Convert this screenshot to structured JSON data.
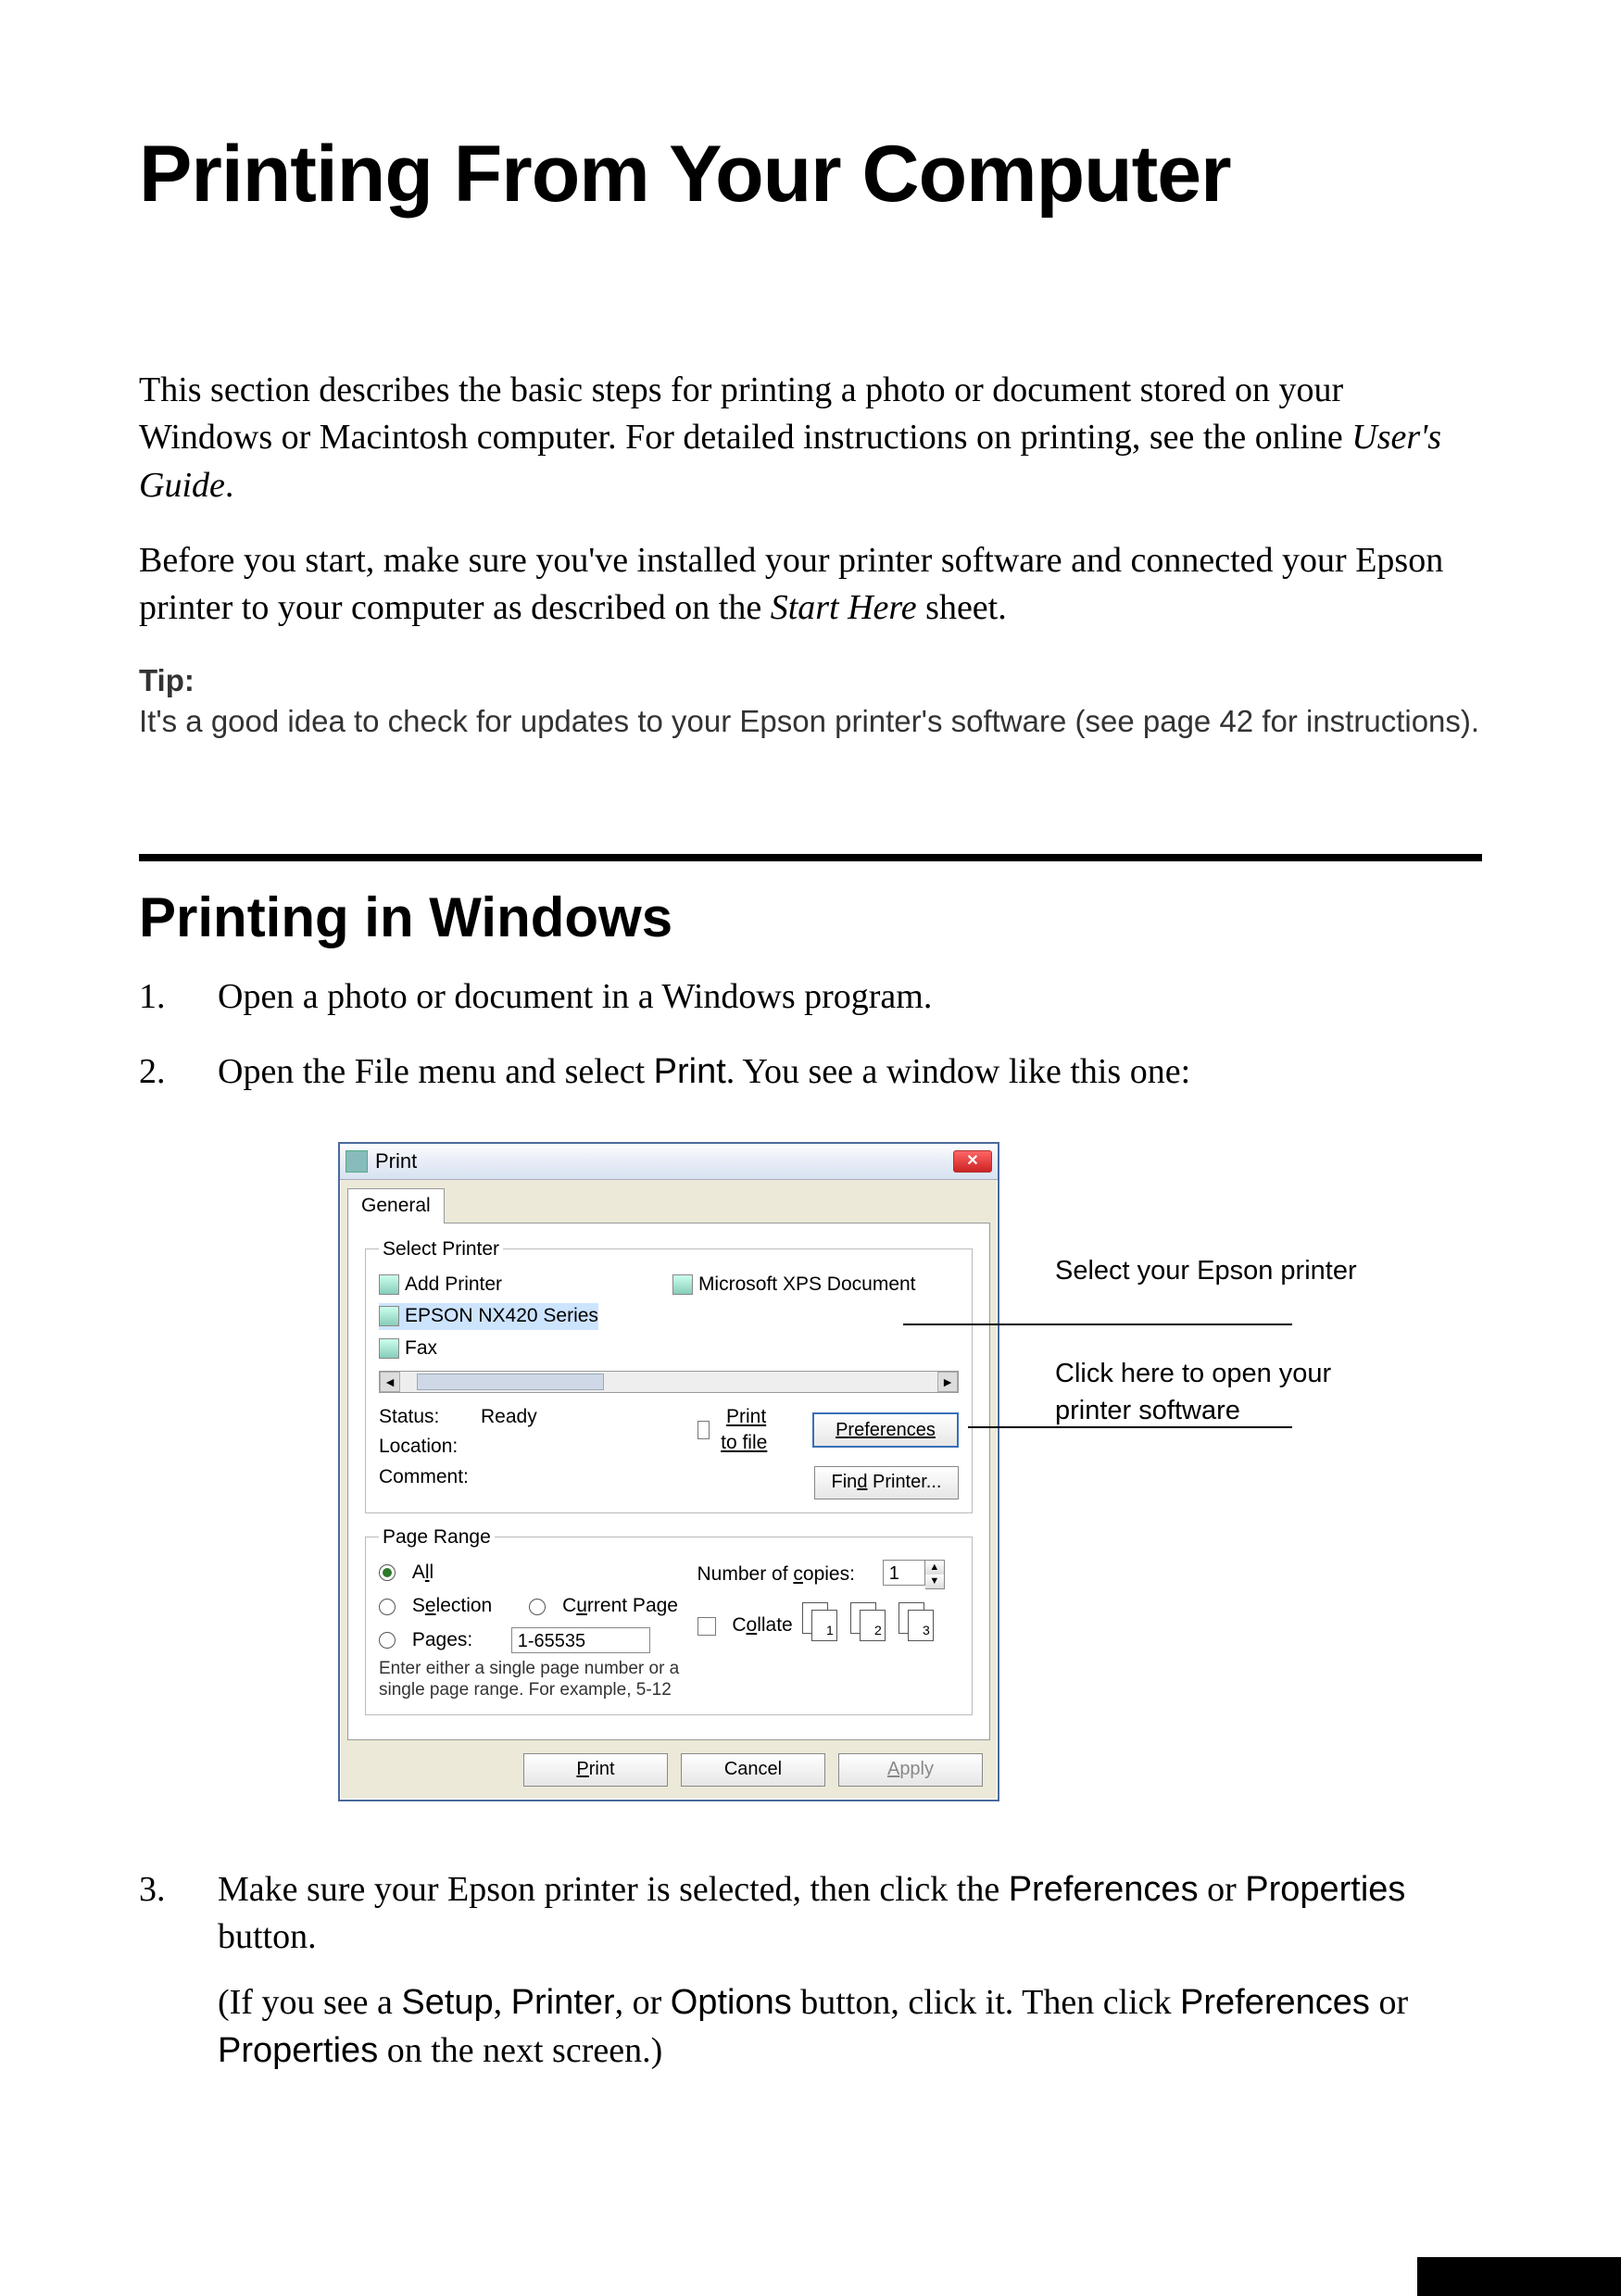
{
  "title": "Printing From Your Computer",
  "intro1_a": "This section describes the basic steps for printing a photo or document stored on your Windows or Macintosh computer. For detailed instructions on printing, see the online ",
  "intro1_em": "User's Guide",
  "intro1_b": ".",
  "intro2_a": "Before you start, make sure you've installed your printer software and connected your Epson printer to your computer as described on the ",
  "intro2_em": "Start Here",
  "intro2_b": " sheet.",
  "tip_label": "Tip:",
  "tip_body": "It's a good idea to check for updates to your Epson printer's software (see page 42 for instructions).",
  "section": "Printing in Windows",
  "steps": {
    "s1": "Open a photo or document in a Windows program.",
    "s2_a": "Open the File menu and select ",
    "s2_b": "Print",
    "s2_c": ". You see a window like this one:",
    "s3_a": "Make sure your Epson printer is selected, then click the ",
    "s3_b": "Preferences",
    "s3_c": " or ",
    "s3_d": "Properties",
    "s3_e": " button.",
    "s3_f": "(If you see a ",
    "s3_g": "Setup",
    "s3_h": ", ",
    "s3_i": "Printer",
    "s3_j": ", or ",
    "s3_k": "Options",
    "s3_l": " button, click it. Then click ",
    "s3_m": "Preferences",
    "s3_n": " or ",
    "s3_o": "Properties",
    "s3_p": " on the next screen.)"
  },
  "callout1": "Select your Epson printer",
  "callout2": "Click here to open your printer software",
  "dlg": {
    "title": "Print",
    "close": "✕",
    "tab": "General",
    "grp_select": "Select Printer",
    "printers": {
      "p0": "Add Printer",
      "p1": "EPSON NX420 Series",
      "p2": "Fax",
      "p3": "Microsoft XPS Document"
    },
    "scroll_l": "◄",
    "scroll_r": "►",
    "status_lbl": "Status:",
    "status_val": "Ready",
    "loc_lbl": "Location:",
    "cmt_lbl": "Comment:",
    "ptf": "Print to file",
    "pref": "Preferences",
    "find": "Find Printer...",
    "grp_range": "Page Range",
    "all": "All",
    "selection": "Selection",
    "curpage": "Current Page",
    "pages": "Pages:",
    "pages_val": "1-65535",
    "help": "Enter either a single page number or a single page range.  For example, 5-12",
    "copies_lbl": "Number of copies:",
    "copies_val": "1",
    "collate": "Collate",
    "pair1a": "1",
    "pair1b": "1",
    "pair2a": "2",
    "pair2b": "2",
    "pair3a": "3",
    "pair3b": "3",
    "btn_print": "Print",
    "btn_cancel": "Cancel",
    "btn_apply": "Apply"
  }
}
